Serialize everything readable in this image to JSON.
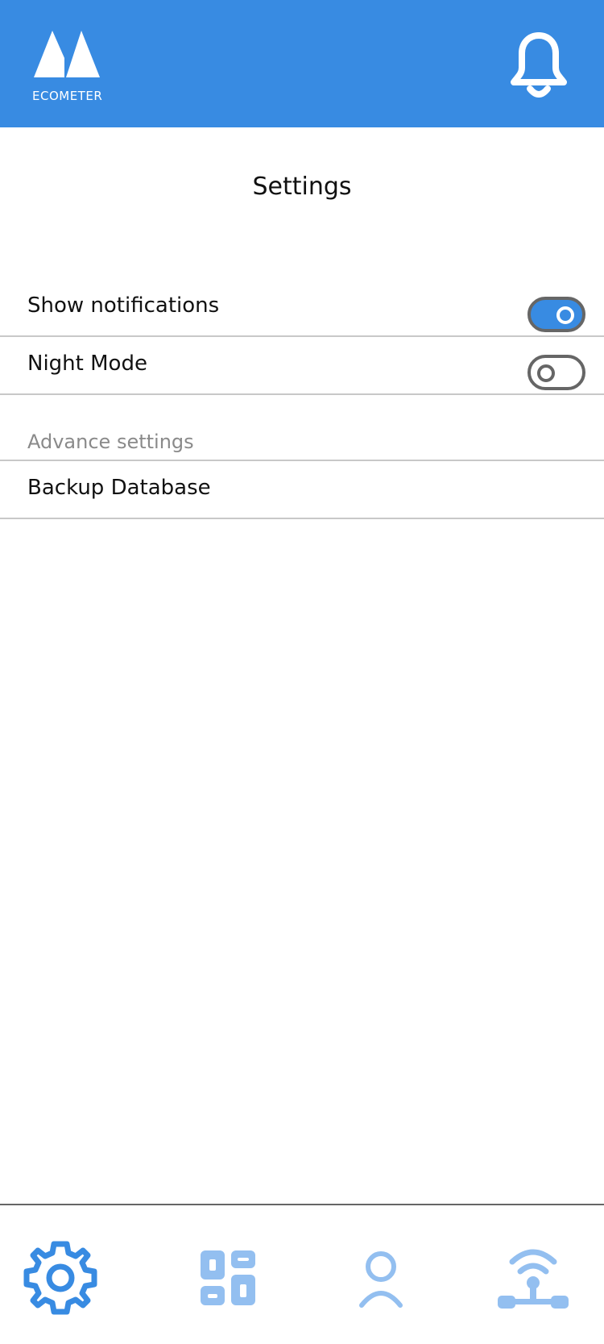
{
  "header": {
    "app_name": "ECOMETER",
    "notification_icon": "bell-icon",
    "logo_icon": "ecometer-logo"
  },
  "page": {
    "title": "Settings"
  },
  "settings": [
    {
      "label": "Show notifications",
      "enabled": true
    },
    {
      "label": "Night Mode",
      "enabled": false
    }
  ],
  "advanced": {
    "section_label": "Advance settings",
    "items": [
      {
        "label": "Backup Database"
      }
    ]
  },
  "bottom_nav": {
    "items": [
      {
        "icon": "gear-icon",
        "active": true
      },
      {
        "icon": "dashboard-icon",
        "active": false
      },
      {
        "icon": "user-icon",
        "active": false
      },
      {
        "icon": "network-icon",
        "active": false
      }
    ]
  },
  "colors": {
    "primary": "#388be2",
    "nav_inactive": "#93bff0",
    "divider": "#c8c8c8",
    "muted_text": "#8a8a8a"
  }
}
